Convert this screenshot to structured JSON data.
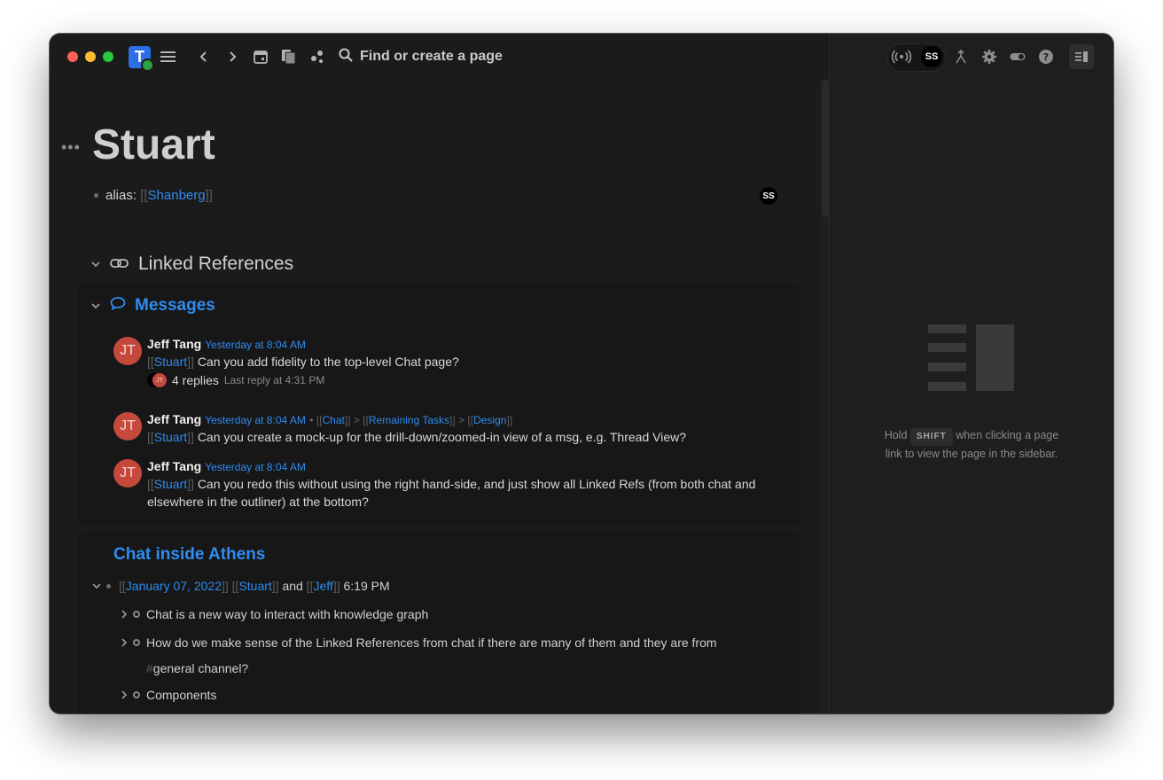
{
  "toolbar": {
    "logo_letter": "T",
    "search_placeholder": "Find or create a page",
    "colors": {
      "accent": "#2f8cf0",
      "logo_bg": "#2d6ee6",
      "online": "#2ea043"
    }
  },
  "page": {
    "title": "Stuart",
    "alias_label": "alias:",
    "alias_value": "Shanberg",
    "presence_initials": "SS",
    "linked_refs_label": "Linked References"
  },
  "messages_section": {
    "title": "Messages",
    "items": [
      {
        "initials": "JT",
        "author": "Jeff Tang",
        "time": "Yesterday at 8:04 AM",
        "crumbs": "",
        "ref": "Stuart",
        "text": "Can you add fidelity to the top-level Chat page?",
        "replies": "4 replies",
        "last_reply": "Last reply at 4:31 PM"
      },
      {
        "initials": "JT",
        "author": "Jeff Tang",
        "time": "Yesterday at 8:04 AM",
        "crumbs": [
          "Chat",
          "Remaining Tasks",
          "Design"
        ],
        "ref": "Stuart",
        "text": "Can you create a mock-up for the drill-down/zoomed-in view of a msg, e.g. Thread View?"
      },
      {
        "initials": "JT",
        "author": "Jeff Tang",
        "time": "Yesterday at 8:04 AM",
        "crumbs": "",
        "ref": "Stuart",
        "text": "Can you redo this without using the right hand-side, and just show all Linked Refs (from both chat and elsewhere in the outliner) at the bottom?"
      }
    ]
  },
  "chat_section": {
    "title": "Chat inside Athens",
    "date_link": "January 07, 2022",
    "ref1": "Stuart",
    "and": "and",
    "ref2": "Jeff",
    "time": "6:19 PM",
    "children": [
      "Chat is a new way to interact with knowledge graph",
      "How do we make sense of the Linked References from chat if there are many of them and they are from",
      "Components"
    ],
    "hashtag": "general channel?"
  },
  "sidebar": {
    "presence_initials": "SS",
    "hint_before": "Hold",
    "hint_key": "SHIFT",
    "hint_after": "when clicking a page link to view the page in the sidebar."
  }
}
